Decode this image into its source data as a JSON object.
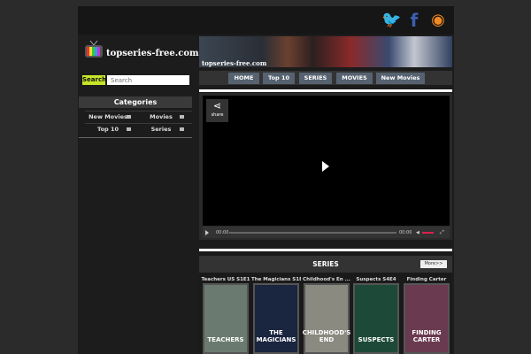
{
  "site": {
    "name": "topseries-free.com",
    "banner_text": "topseries-free.com"
  },
  "social": [
    {
      "icon": "twitter-icon",
      "glyph": "🐦",
      "color": "#3aa7e0"
    },
    {
      "icon": "facebook-icon",
      "glyph": "f",
      "color": "#3b5fb0"
    },
    {
      "icon": "rss-icon",
      "glyph": "◉",
      "color": "#f08a24"
    }
  ],
  "search": {
    "button": "Search",
    "placeholder": "Search"
  },
  "categories": {
    "title": "Categories",
    "items": [
      "New Movies",
      "Movies",
      "Top 10",
      "Series"
    ]
  },
  "nav": [
    "HOME",
    "Top 10",
    "SERIES",
    "MOVIES",
    "New Movies"
  ],
  "player": {
    "share": "share",
    "time_current": "00:00",
    "time_total": "00:00",
    "volume_color": "#e0204a"
  },
  "series": {
    "title": "SERIES",
    "more": "More>>",
    "items": [
      {
        "title": "Teachers US S1E1",
        "poster_text": "TEACHERS",
        "color": "#6a7a70"
      },
      {
        "title": "The Magicians S1E1",
        "poster_text": "THE MAGICIANS",
        "color": "#1a2540"
      },
      {
        "title": "Childhood's En ...",
        "poster_text": "CHILDHOOD'S END",
        "color": "#8a8a80"
      },
      {
        "title": "Suspects S4E4",
        "poster_text": "SUSPECTS",
        "color": "#1d4a38"
      },
      {
        "title": "Finding Carter",
        "poster_text": "FINDING CARTER",
        "color": "#6a3a50"
      }
    ]
  }
}
